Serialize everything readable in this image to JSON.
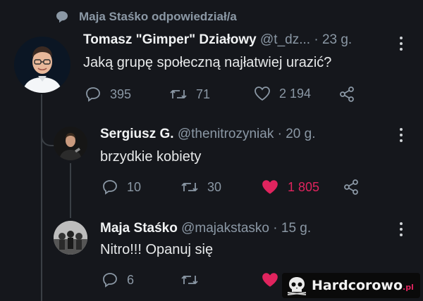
{
  "retweet_header": {
    "text": "Maja Staśko odpowiedział/a"
  },
  "tweets": [
    {
      "name": "Tomasz \"Gimper\" Działowy",
      "handle": "@t_dz...",
      "time": "· 23 g.",
      "text": "Jaką grupę społeczną najłatwiej urazić?",
      "replies": "395",
      "retweets": "71",
      "likes": "2 194",
      "liked": false
    },
    {
      "name": "Sergiusz G.",
      "handle": "@thenitrozyniak",
      "time": "· 20 g.",
      "text": "brzydkie kobiety",
      "replies": "10",
      "retweets": "30",
      "likes": "1 805",
      "liked": true
    },
    {
      "name": "Maja Staśko",
      "handle": "@majakstasko",
      "time": "· 15 g.",
      "text": "Nitro!!! Opanuj się",
      "replies": "6",
      "retweets": "",
      "likes": "",
      "liked": true
    }
  ],
  "watermark": {
    "text": "Hardcorowo",
    "suffix": ".pl"
  },
  "colors": {
    "background": "#15171c",
    "like_active": "#e0245e",
    "muted": "#8b98a5"
  }
}
